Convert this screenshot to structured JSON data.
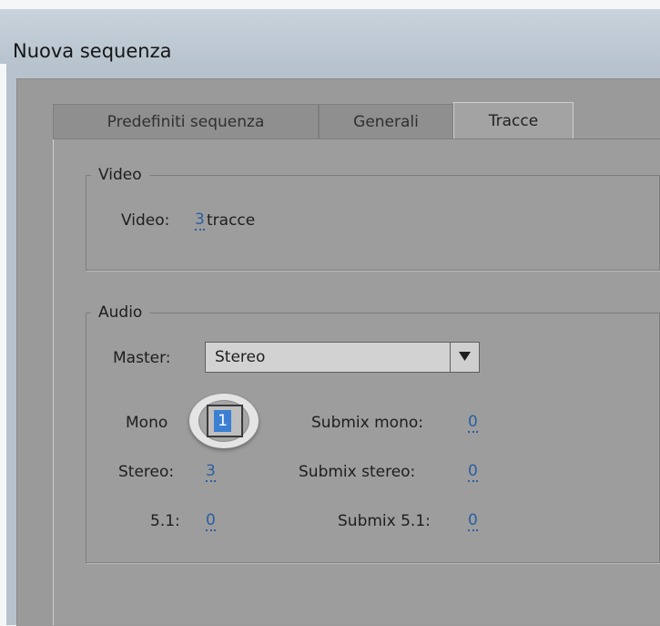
{
  "window": {
    "title": "Nuova sequenza"
  },
  "tabs": [
    {
      "label": "Predefiniti sequenza",
      "active": false
    },
    {
      "label": "Generali",
      "active": false
    },
    {
      "label": "Tracce",
      "active": true
    }
  ],
  "video": {
    "legend": "Video",
    "label": "Video:",
    "value": "3",
    "suffix": "tracce"
  },
  "audio": {
    "legend": "Audio",
    "master_label": "Master:",
    "master_value": "Stereo",
    "mono_label": "Mono",
    "mono_value": "1",
    "stereo_label": "Stereo:",
    "stereo_value": "3",
    "five_one_label": "5.1:",
    "five_one_value": "0",
    "submix_mono_label": "Submix mono:",
    "submix_mono_value": "0",
    "submix_stereo_label": "Submix stereo:",
    "submix_stereo_value": "0",
    "submix_51_label": "Submix 5.1:",
    "submix_51_value": "0"
  },
  "colors": {
    "dialog_bg": "#9d9d9d",
    "link_value": "#2a5fa0",
    "selection": "#3b7fd2"
  }
}
